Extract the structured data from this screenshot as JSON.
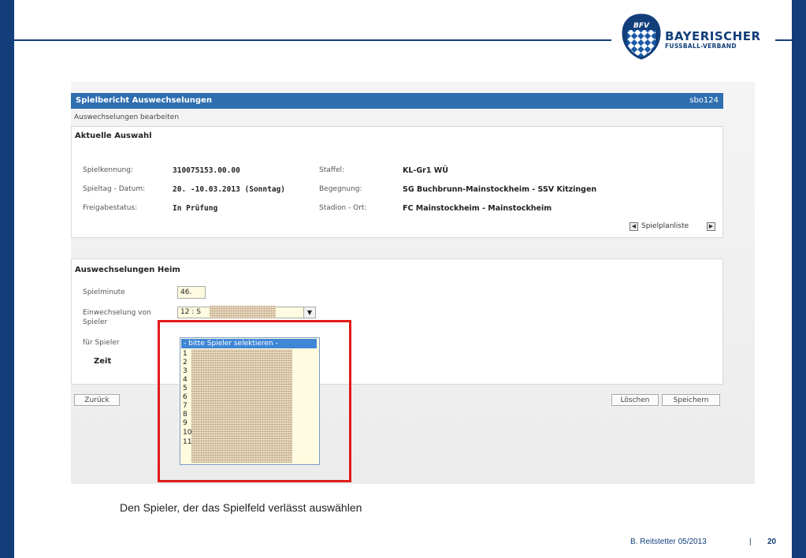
{
  "brand": {
    "line1": "BAYERISCHER",
    "line2": "FUSSBALL-VERBAND",
    "emblem_text": "BFV",
    "color": "#123f7a"
  },
  "app": {
    "title": "Spielbericht Auswechselungen",
    "code": "sbo124",
    "subtitle": "Auswechselungen bearbeiten",
    "current": {
      "heading": "Aktuelle Auswahl",
      "fields": [
        {
          "label": "Spielkennung:",
          "value": "310075153.00.00"
        },
        {
          "label": "Spieltag - Datum:",
          "value": "20. -10.03.2013 (Sonntag)"
        },
        {
          "label": "Freigabestatus:",
          "value": "In Prüfung"
        },
        {
          "label": "Staffel:",
          "value": "KL-Gr1 WÜ"
        },
        {
          "label": "Begegnung:",
          "value": "SG Buchbrunn-Mainstockheim - SSV Kitzingen"
        },
        {
          "label": "Stadion - Ort:",
          "value": "FC Mainstockheim - Mainstockheim"
        }
      ],
      "nav_label": "Spielplanliste"
    },
    "subs": {
      "heading": "Auswechselungen Heim",
      "minute_label": "Spielminute",
      "minute_value": "46.",
      "in_label": "Einwechselung von Spieler",
      "in_value": "12 : S",
      "out_label": "für Spieler",
      "time_label": "Zeit",
      "dropdown_selected": "- bitte Spieler selektieren -",
      "dropdown_options": [
        "1",
        "2",
        "3",
        "4",
        "5",
        "6",
        "7",
        "8",
        "9",
        "10",
        "11"
      ]
    },
    "buttons": {
      "back": "Zurück",
      "delete": "Löschen",
      "save": "Speichern"
    }
  },
  "caption": "Den Spieler, der das Spielfeld verlässt auswählen",
  "footer": {
    "author": "B. Reitstetter  05/2013",
    "separator": "|",
    "page": "20"
  },
  "colors": {
    "titlebar": "#2f6fb0",
    "highlight": "#e01b1b",
    "selection": "#3f86d6"
  }
}
